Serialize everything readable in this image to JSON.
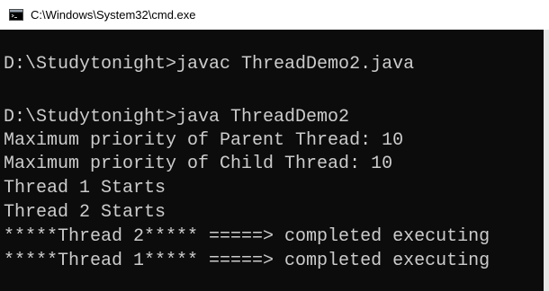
{
  "window": {
    "title": "C:\\Windows\\System32\\cmd.exe",
    "icon": "cmd-icon"
  },
  "console": {
    "lines": [
      "",
      "D:\\Studytonight>javac ThreadDemo2.java",
      "",
      "D:\\Studytonight>java ThreadDemo2",
      "Maximum priority of Parent Thread: 10",
      "Maximum priority of Child Thread: 10",
      "Thread 1 Starts",
      "Thread 2 Starts",
      "*****Thread 2***** =====> completed executing",
      "*****Thread 1***** =====> completed executing"
    ]
  },
  "colors": {
    "console_bg": "#0c0c0c",
    "console_text": "#cccccc",
    "titlebar_bg": "#ffffff"
  }
}
